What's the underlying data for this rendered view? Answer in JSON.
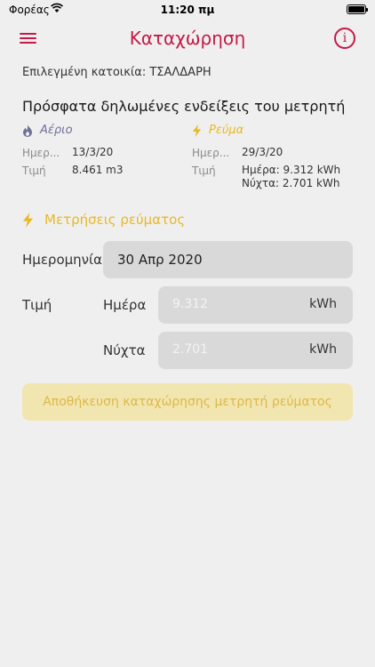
{
  "status_bar": {
    "carrier": "Φορέας",
    "time": "11:20 πμ"
  },
  "nav": {
    "title": "Καταχώρηση",
    "info_symbol": "i"
  },
  "home": {
    "label": "Επιλεγμένη κατοικία: ΤΣΑΛΔΑΡΗ"
  },
  "recent": {
    "title": "Πρόσφατα δηλωμένες ενδείξεις του μετρητή",
    "gas": {
      "heading": "Αέριο",
      "icon": "flame-icon",
      "date_label": "Ημερ...",
      "date": "13/3/20",
      "value_label": "Τιμή",
      "value": "8.461 m3"
    },
    "electricity": {
      "heading": "Ρεύμα",
      "icon": "lightning-icon",
      "date_label": "Ημερ...",
      "date": "29/3/20",
      "value_label": "Τιμή",
      "value_day": "Ημέρα: 9.312 kWh",
      "value_night": "Νύχτα: 2.701 kWh"
    }
  },
  "form": {
    "heading": "Μετρήσεις ρεύματος",
    "date_label": "Ημερομηνία",
    "date_value": "30 Απρ 2020",
    "value_label": "Τιμή",
    "day_label": "Ημέρα",
    "day_placeholder": "9.312",
    "night_label": "Νύχτα",
    "night_placeholder": "2.701",
    "unit": "kWh",
    "save_label": "Αποθήκευση καταχώρησης μετρητή ρεύματος"
  },
  "colors": {
    "accent": "#c41a48",
    "gas": "#6f6f9a",
    "electricity": "#e8b923",
    "background": "#efefef",
    "field": "#d9d9d9",
    "button_disabled_bg": "#f2e6b0"
  }
}
